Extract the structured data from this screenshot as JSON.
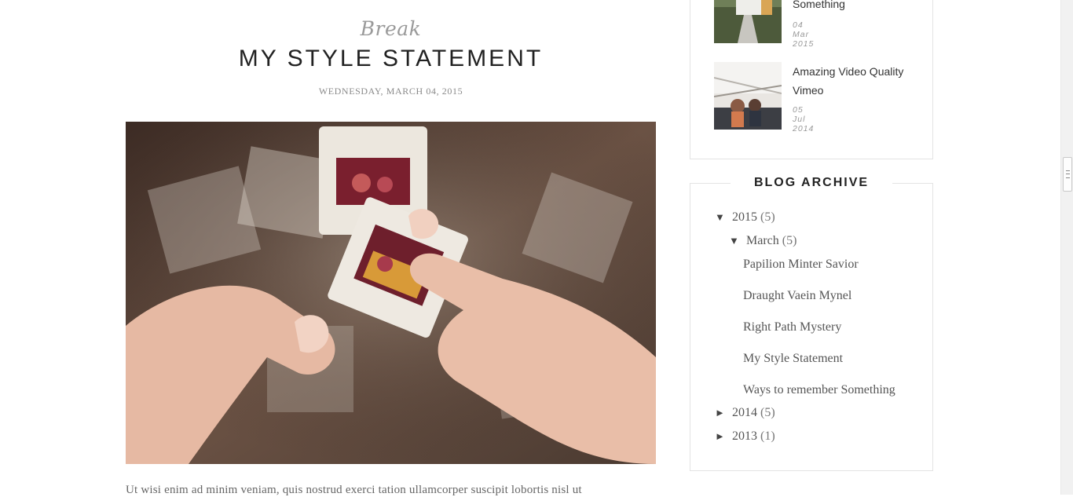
{
  "post": {
    "label": "Break",
    "title": "MY STYLE STATEMENT",
    "date": "WEDNESDAY, MARCH 04, 2015",
    "body": "Ut wisi enim ad minim veniam, quis nostrud exerci tation ullamcorper suscipit lobortis nisl ut"
  },
  "popular_posts": [
    {
      "title": "Something",
      "date": "04 Mar 2015"
    },
    {
      "title": "Amazing Video Quality Vimeo",
      "date": "05 Jul 2014"
    }
  ],
  "archive": {
    "title": "BLOG ARCHIVE",
    "year_2015": {
      "toggle": "▼",
      "label": "2015",
      "count": "(5)"
    },
    "month_march": {
      "toggle": "▼",
      "label": "March",
      "count": "(5)"
    },
    "posts": [
      "Papilion Minter Savior",
      "Draught Vaein Mynel",
      "Right Path Mystery",
      "My Style Statement",
      "Ways to remember Something"
    ],
    "year_2014": {
      "toggle": "►",
      "label": "2014",
      "count": "(5)"
    },
    "year_2013": {
      "toggle": "►",
      "label": "2013",
      "count": "(1)"
    }
  }
}
